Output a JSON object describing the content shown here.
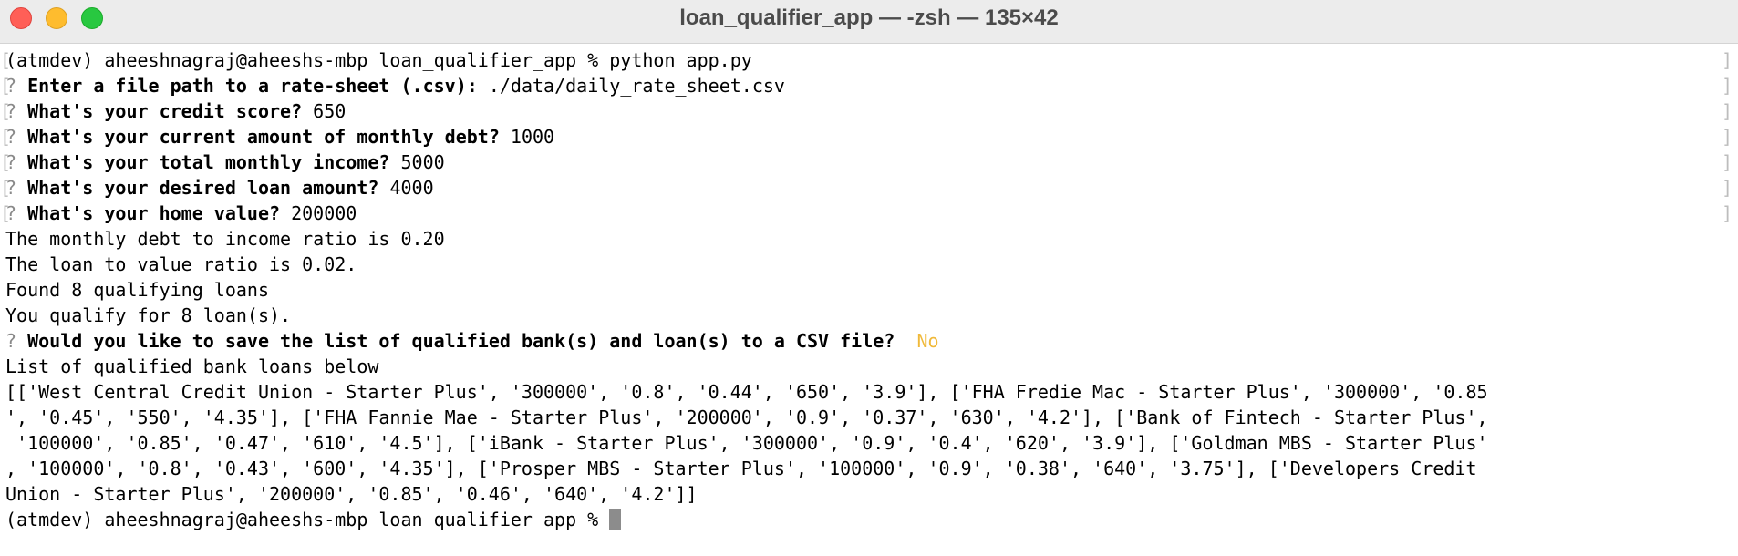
{
  "window": {
    "title": "loan_qualifier_app — -zsh — 135×42"
  },
  "terminal": {
    "prompt": "(atmdev) aheeshnagraj@aheeshs-mbp loan_qualifier_app % ",
    "command": "python app.py",
    "question_mark": "?",
    "questions": [
      {
        "label": "Enter a file path to a rate-sheet (.csv):",
        "answer": "./data/daily_rate_sheet.csv"
      },
      {
        "label": "What's your credit score?",
        "answer": "650"
      },
      {
        "label": "What's your current amount of monthly debt?",
        "answer": "1000"
      },
      {
        "label": "What's your total monthly income?",
        "answer": "5000"
      },
      {
        "label": "What's your desired loan amount?",
        "answer": "4000"
      },
      {
        "label": "What's your home value?",
        "answer": "200000"
      }
    ],
    "output_lines": [
      "The monthly debt to income ratio is 0.20",
      "The loan to value ratio is 0.02.",
      "Found 8 qualifying loans",
      "You qualify for 8 loan(s)."
    ],
    "save_question": "Would you like to save the list of qualified bank(s) and loan(s) to a CSV file?",
    "save_answer": "No",
    "list_header": "List of qualified bank loans below",
    "list_lines": [
      "[['West Central Credit Union - Starter Plus', '300000', '0.8', '0.44', '650', '3.9'], ['FHA Fredie Mac - Starter Plus', '300000', '0.85",
      "', '0.45', '550', '4.35'], ['FHA Fannie Mae - Starter Plus', '200000', '0.9', '0.37', '630', '4.2'], ['Bank of Fintech - Starter Plus',",
      " '100000', '0.85', '0.47', '610', '4.5'], ['iBank - Starter Plus', '300000', '0.9', '0.4', '620', '3.9'], ['Goldman MBS - Starter Plus'",
      ", '100000', '0.8', '0.43', '600', '4.35'], ['Prosper MBS - Starter Plus', '100000', '0.9', '0.38', '640', '3.75'], ['Developers Credit",
      "Union - Starter Plus', '200000', '0.85', '0.46', '640', '4.2']]"
    ],
    "final_prompt": "(atmdev) aheeshnagraj@aheeshs-mbp loan_qualifier_app % "
  }
}
